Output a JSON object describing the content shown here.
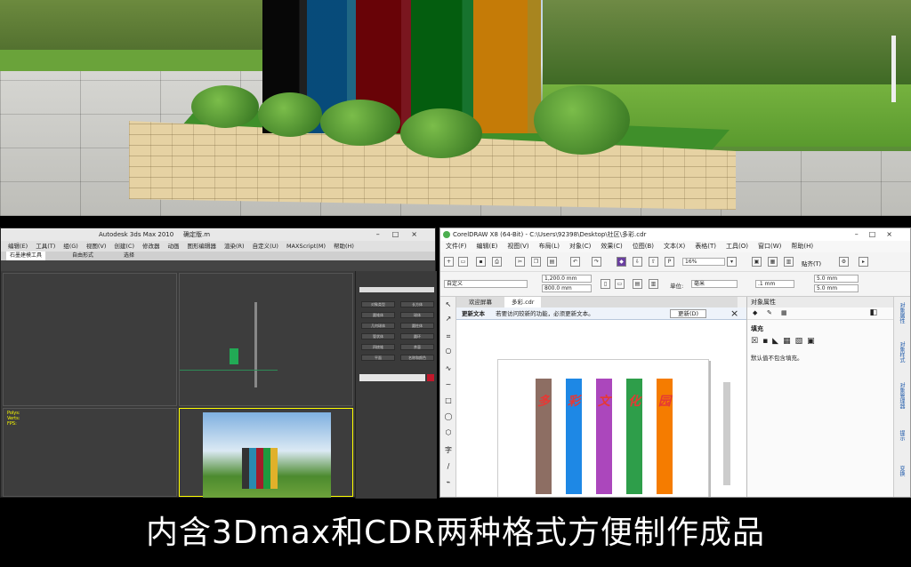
{
  "caption": "内含3Dmax和CDR两种格式方便制作成品",
  "scene": {
    "pillar_colors": [
      "#2b2b2b",
      "#2a8ab0",
      "#a31d2a",
      "#1f9a3e",
      "#e0b12a"
    ]
  },
  "max_window": {
    "title": "Autodesk 3ds Max  2010",
    "file": "确定版.m",
    "menu": [
      "编辑(E)",
      "工具(T)",
      "组(G)",
      "视图(V)",
      "创建(C)",
      "修改器",
      "动画",
      "图形编辑器",
      "渲染(R)",
      "自定义(U)",
      "MAXScript(M)",
      "帮助(H)"
    ],
    "ribbon_tabs": [
      "石墨建模工具",
      "自由形式",
      "选择"
    ],
    "readout": [
      "Polys:",
      "Verts:",
      "FPS:"
    ],
    "cmd_buttons": [
      "对象类型",
      "长方体",
      "圆锥体",
      "球体",
      "几何球体",
      "圆柱体",
      "管状体",
      "圆环",
      "四棱锥",
      "茶壶",
      "平面",
      "名称和颜色"
    ]
  },
  "cdr_window": {
    "title": "CorelDRAW X8 (64-Bit) - C:\\Users\\92398\\Desktop\\社区\\多彩.cdr",
    "menu": [
      "文件(F)",
      "编辑(E)",
      "视图(V)",
      "布局(L)",
      "对象(C)",
      "效果(C)",
      "位图(B)",
      "文本(X)",
      "表格(T)",
      "工具(O)",
      "窗口(W)",
      "帮助(H)"
    ],
    "zoom": "16%",
    "snap": "贴齐(T)",
    "page_preset": "自定义",
    "width": "1,200.0 mm",
    "height": "800.0 mm",
    "units_label": "单位:",
    "units": "毫米",
    "nudge": ".1 mm",
    "dup_x": "5.0 mm",
    "dup_y": "5.0 mm",
    "tabs": [
      "欢迎屏幕",
      "多彩.cdr"
    ],
    "infobar_title": "更新文本",
    "infobar_text": "若要访问较新的功能，必须更新文本。",
    "infobar_button": "更新(D)",
    "strip_colors": [
      "#8d6e63",
      "#1e88e5",
      "#ab47bc",
      "#2e9e4a",
      "#f57c00"
    ],
    "strip_chars": [
      "多",
      "彩",
      "文",
      "化",
      "园"
    ],
    "dock_title": "对象属性",
    "dock_section": "填充",
    "dock_text": "默认值不包含填充。",
    "vtabs": [
      "对象属性",
      "对象样式",
      "对象管理器",
      "提示",
      "变换"
    ]
  }
}
